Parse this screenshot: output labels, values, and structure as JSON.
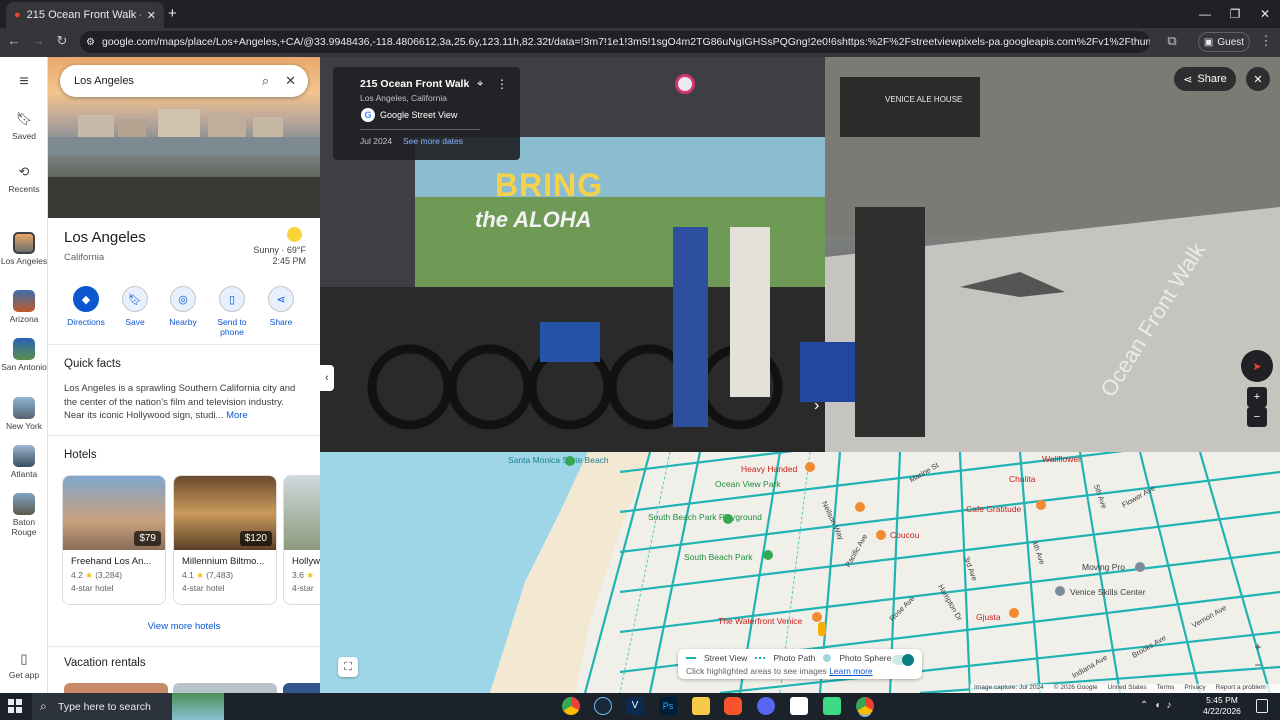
{
  "browser": {
    "tab_title": "215 Ocean Front Walk - Google",
    "url": "google.com/maps/place/Los+Angeles,+CA/@33.9948436,-118.4806612,3a,25.6y,123.11h,82.32t/data=!3m7!1e1!3m5!1sgO4m2TG86uNgIGHSsPQGng!2e0!6shttps:%2F%2Fstreetviewpixels-pa.googleapis.com%2Fv1%2Fthumbnail%3Fcb_client%3Dmaps...",
    "profile": "Guest"
  },
  "rail": {
    "items": [
      {
        "label": "Saved",
        "icon": "bookmark-icon"
      },
      {
        "label": "Recents",
        "icon": "history-icon"
      },
      {
        "label": "Los Angeles"
      },
      {
        "label": "Arizona"
      },
      {
        "label": "San Antonio"
      },
      {
        "label": "New York"
      },
      {
        "label": "Atlanta"
      },
      {
        "label": "Baton Rouge"
      }
    ],
    "get_app": "Get app"
  },
  "panel": {
    "search_value": "Los Angeles",
    "place_name": "Los Angeles",
    "place_region": "California",
    "weather": "Sunny · 69°F",
    "time": "2:45 PM",
    "actions": [
      "Directions",
      "Save",
      "Nearby",
      "Send to phone",
      "Share"
    ],
    "quick_facts_title": "Quick facts",
    "quick_facts_text": "Los Angeles is a sprawling Southern California city and the center of the nation’s film and television industry. Near its iconic Hollywood sign, studi...",
    "more_link": "More",
    "hotels_title": "Hotels",
    "hotels": [
      {
        "name": "Freehand Los An...",
        "price": "$79",
        "rating": "4.2",
        "reviews": "(3,284)",
        "type": "4-star hotel"
      },
      {
        "name": "Millennium Biltmo...",
        "price": "$120",
        "rating": "4.1",
        "reviews": "(7,483)",
        "type": "4-star hotel"
      },
      {
        "name": "Hollyw",
        "price": "",
        "rating": "3.6",
        "reviews": "",
        "type": "4-star"
      }
    ],
    "view_more_hotels": "View more hotels",
    "vacation_rentals_title": "Vacation rentals"
  },
  "streetview": {
    "address": "215 Ocean Front Walk",
    "city": "Los Angeles, California",
    "source": "Google Street View",
    "date": "Jul 2024",
    "see_more_dates": "See more dates",
    "share_label": "Share",
    "mural_text_1": "BRING",
    "mural_text_2": "the ALOHA",
    "shop_sign": "VENICE ALE HOUSE",
    "road_text": "Ocean Front Walk"
  },
  "map": {
    "pois": [
      "Santa Monica State Beach",
      "Heavy Handed",
      "Ocean View Park",
      "South Beach Park Playground",
      "South Beach Park",
      "Coucou",
      "Chulita",
      "Cafe Gratitude",
      "Moving Pro",
      "Venice Skills Center",
      "Gjusta",
      "The Waterfront Venice",
      "Wallflower"
    ],
    "streets": [
      "Marine St",
      "Neilson Way",
      "Pacific Ave",
      "Rose Ave",
      "Hampton Dr",
      "Main St",
      "3rd Ave",
      "4th Ave",
      "5th Ave",
      "6th Ave",
      "Flower Ave",
      "Brooks Ave",
      "Vernon Ave",
      "Indiana Ave"
    ],
    "legend": {
      "street_view": "Street View",
      "photo_path": "Photo Path",
      "photo_sphere": "Photo Sphere",
      "hint": "Click highlighted areas to see images",
      "learn_more": "Learn more"
    },
    "footer": [
      "Image capture: Jul 2024",
      "© 2026 Google",
      "United States",
      "Terms",
      "Privacy",
      "Report a problem"
    ]
  },
  "taskbar": {
    "search_placeholder": "Type here to search",
    "time": "5:45 PM",
    "date": "4/22/2026"
  },
  "colors": {
    "street_view_line": "#1fb3b3",
    "water": "#9ed6e8",
    "accent": "#0b57d0"
  }
}
